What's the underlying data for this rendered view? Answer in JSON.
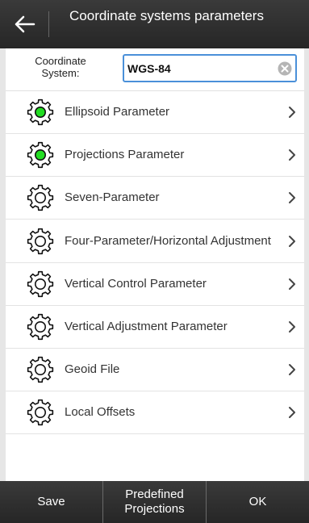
{
  "header": {
    "title": "Coordinate systems parameters",
    "back_icon": "back-arrow-icon"
  },
  "coordinate_system": {
    "label": "Coordinate System:",
    "value": "WGS-84",
    "clear_icon": "clear-icon"
  },
  "menu_items": [
    {
      "label": "Ellipsoid Parameter",
      "icon": "gear-icon",
      "active": true
    },
    {
      "label": "Projections Parameter",
      "icon": "gear-icon",
      "active": true
    },
    {
      "label": "Seven-Parameter",
      "icon": "gear-icon",
      "active": false
    },
    {
      "label": "Four-Parameter/Horizontal Adjustment",
      "icon": "gear-icon",
      "active": false
    },
    {
      "label": "Vertical Control Parameter",
      "icon": "gear-icon",
      "active": false
    },
    {
      "label": "Vertical Adjustment Parameter",
      "icon": "gear-icon",
      "active": false
    },
    {
      "label": "Geoid File",
      "icon": "gear-icon",
      "active": false
    },
    {
      "label": "Local Offsets",
      "icon": "gear-icon",
      "active": false
    }
  ],
  "footer": {
    "save_label": "Save",
    "predefined_label": "Predefined Projections",
    "ok_label": "OK"
  },
  "colors": {
    "header_bg": "#2e2e2e",
    "active_gear": "#22dd22",
    "input_border": "#4a90d9"
  }
}
